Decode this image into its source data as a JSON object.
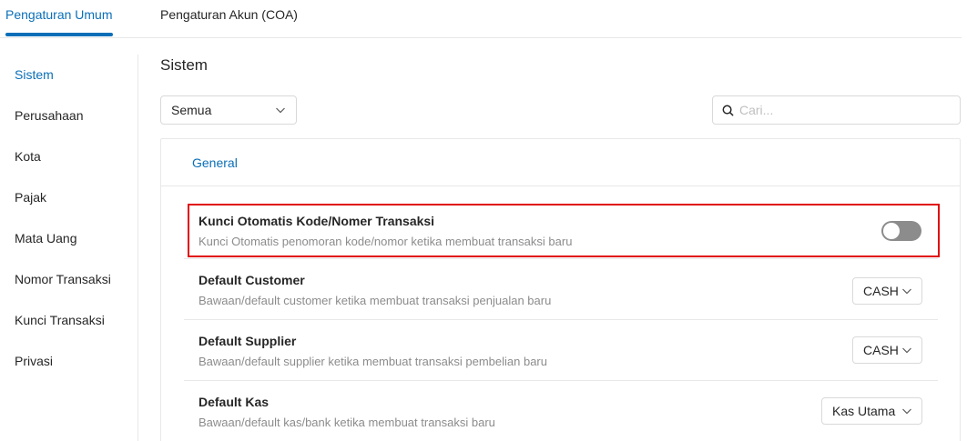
{
  "top_tabs": [
    {
      "label": "Pengaturan Umum",
      "active": true
    },
    {
      "label": "Pengaturan Akun (COA)",
      "active": false
    }
  ],
  "sidebar": {
    "items": [
      {
        "label": "Sistem",
        "active": true
      },
      {
        "label": "Perusahaan"
      },
      {
        "label": "Kota"
      },
      {
        "label": "Pajak"
      },
      {
        "label": "Mata Uang"
      },
      {
        "label": "Nomor Transaksi"
      },
      {
        "label": "Kunci Transaksi"
      },
      {
        "label": "Privasi"
      }
    ]
  },
  "main": {
    "title": "Sistem",
    "filter": {
      "value": "Semua",
      "icon": "chevron-down-icon"
    },
    "search": {
      "placeholder": "Cari...",
      "value": "",
      "icon": "search-icon"
    },
    "section": {
      "label": "General"
    },
    "settings": [
      {
        "title": "Kunci Otomatis Kode/Nomer Transaksi",
        "description": "Kunci Otomatis penomoran kode/nomor ketika membuat transaksi baru",
        "control": "toggle",
        "enabled": false
      },
      {
        "title": "Default Customer",
        "description": "Bawaan/default customer ketika membuat transaksi penjualan baru",
        "control": "select",
        "value": "CASH"
      },
      {
        "title": "Default Supplier",
        "description": "Bawaan/default supplier ketika membuat transaksi pembelian baru",
        "control": "select",
        "value": "CASH"
      },
      {
        "title": "Default Kas",
        "description": "Bawaan/default kas/bank ketika membuat transaksi baru",
        "control": "select",
        "value": "Kas Utama"
      }
    ]
  },
  "colors": {
    "accent": "#0a6fb8",
    "highlight_border": "#e00b0b",
    "toggle_off": "#8c8c8c"
  }
}
